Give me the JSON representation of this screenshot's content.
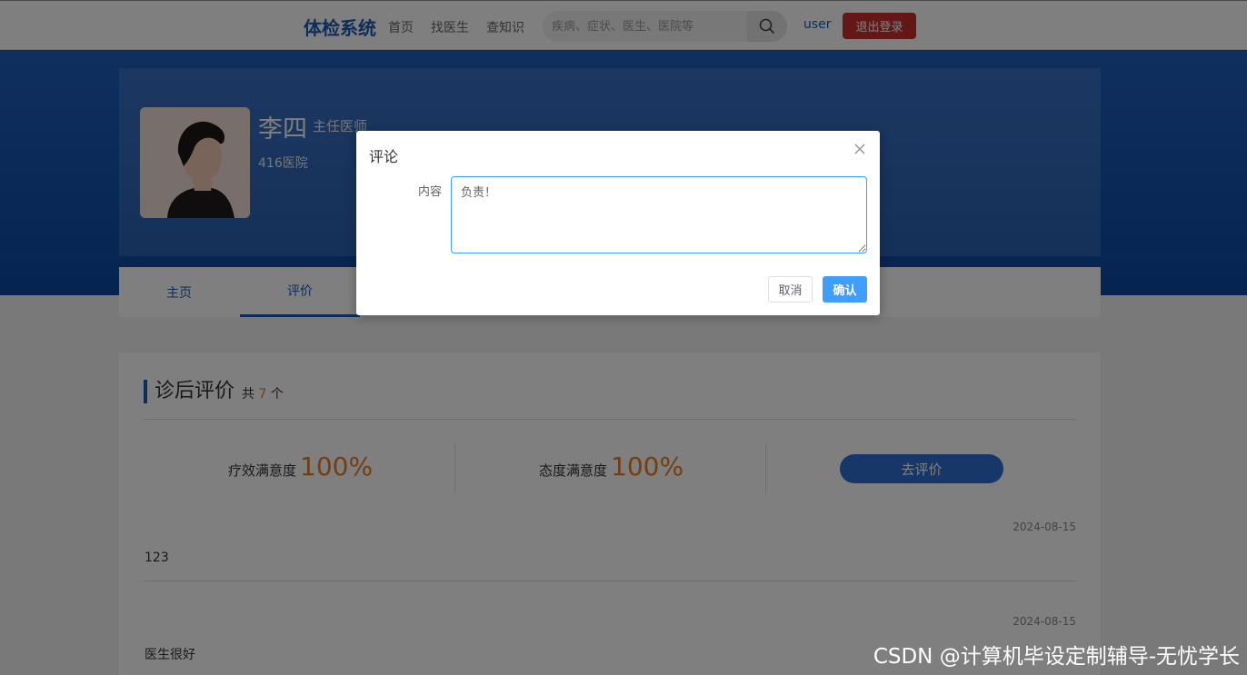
{
  "navbar": {
    "brand": "体检系统",
    "links": [
      "首页",
      "找医生",
      "查知识"
    ],
    "search_placeholder": "疾病、症状、医生、医院等",
    "user": "user",
    "logout_label": "退出登录"
  },
  "doctor": {
    "name": "李四",
    "title": "主任医师",
    "hospital": "416医院"
  },
  "tabs": [
    {
      "label": "主页",
      "active": false
    },
    {
      "label": "评价",
      "active": true
    }
  ],
  "reviews": {
    "section_title": "诊后评价",
    "count_prefix": "共",
    "count": "7",
    "count_suffix": "个",
    "efficacy_label": "疗效满意度",
    "efficacy_value": "100%",
    "attitude_label": "态度满意度",
    "attitude_value": "100%",
    "go_review_label": "去评价",
    "items": [
      {
        "date": "2024-08-15",
        "text": "123"
      },
      {
        "date": "2024-08-15",
        "text": "医生很好"
      }
    ]
  },
  "modal": {
    "title": "评论",
    "field_label": "内容",
    "field_value": "负责！",
    "cancel_label": "取消",
    "confirm_label": "确认"
  },
  "watermark": "CSDN @计算机毕设定制辅导-无忧学长",
  "colors": {
    "brand": "#1a5bb5",
    "logout": "#c9302c",
    "accent_orange": "#e67e22",
    "primary": "#409eff"
  }
}
